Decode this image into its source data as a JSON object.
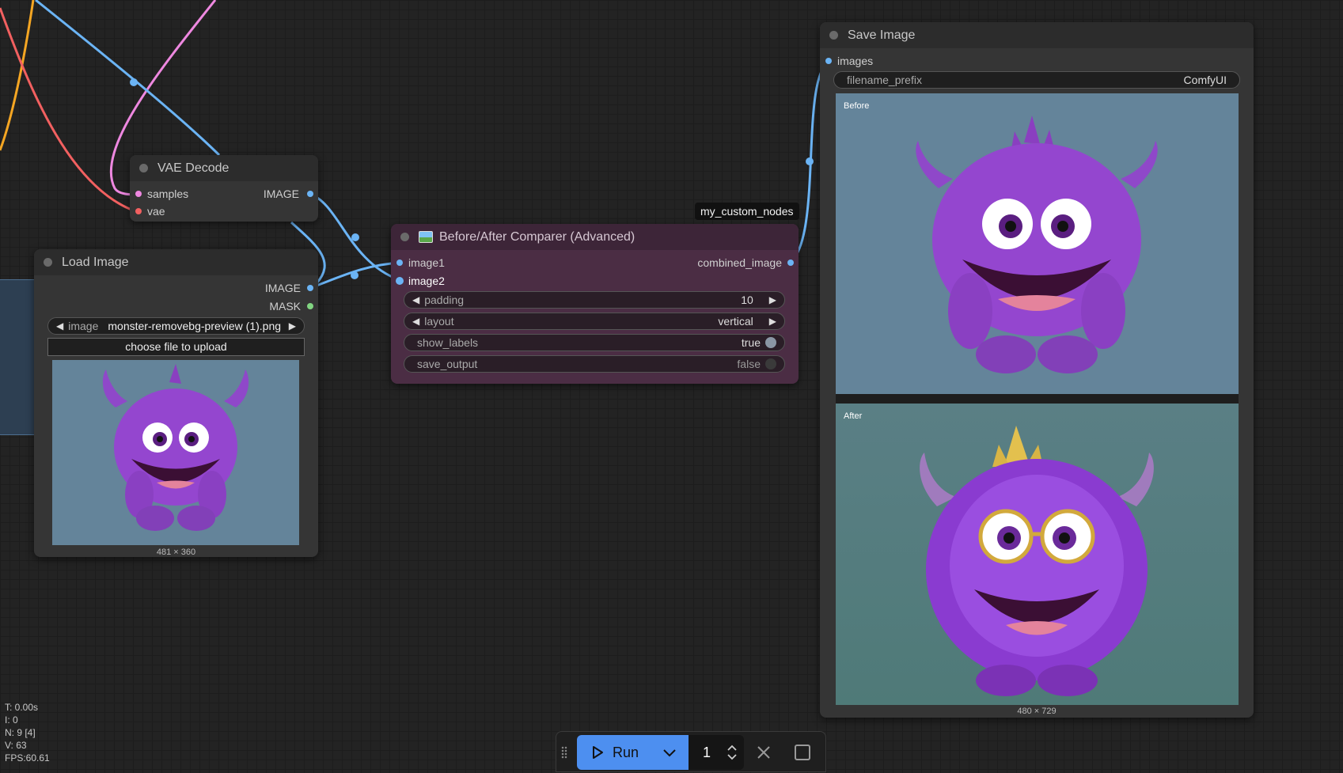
{
  "nodes": {
    "vae_decode": {
      "title": "VAE Decode",
      "inputs": [
        "samples",
        "vae"
      ],
      "outputs": [
        "IMAGE"
      ]
    },
    "load_image": {
      "title": "Load Image",
      "outputs": [
        "IMAGE",
        "MASK"
      ],
      "image_widget": {
        "label": "image",
        "value": "monster-removebg-preview (1).png"
      },
      "upload_button": "choose file to upload",
      "preview_size": "481 × 360"
    },
    "comparer": {
      "badge": "my_custom_nodes",
      "title": "Before/After Comparer (Advanced)",
      "inputs": [
        "image1",
        "image2"
      ],
      "outputs": [
        "combined_image"
      ],
      "widgets": {
        "padding": {
          "label": "padding",
          "value": "10"
        },
        "layout": {
          "label": "layout",
          "value": "vertical"
        },
        "show_labels": {
          "label": "show_labels",
          "value": "true"
        },
        "save_output": {
          "label": "save_output",
          "value": "false"
        }
      }
    },
    "save_image": {
      "title": "Save Image",
      "inputs": [
        "images"
      ],
      "filename_prefix": {
        "label": "filename_prefix",
        "value": "ComfyUI"
      },
      "before_label": "Before",
      "after_label": "After",
      "preview_size": "480 × 729"
    }
  },
  "stats": {
    "t": "T: 0.00s",
    "i": "I: 0",
    "n": "N: 9 [4]",
    "v": "V: 63",
    "fps": "FPS:60.61"
  },
  "toolbar": {
    "run_label": "Run",
    "batch_count": "1"
  },
  "colors": {
    "image_wire": "#6bb4f5",
    "latent_wire": "#ee88e0",
    "vae_wire": "#f26060",
    "clip_wire": "#f5a623",
    "mask_dot": "#81d581",
    "comparer_bg": "#4b2d44",
    "run_blue": "#4d8ff0"
  }
}
